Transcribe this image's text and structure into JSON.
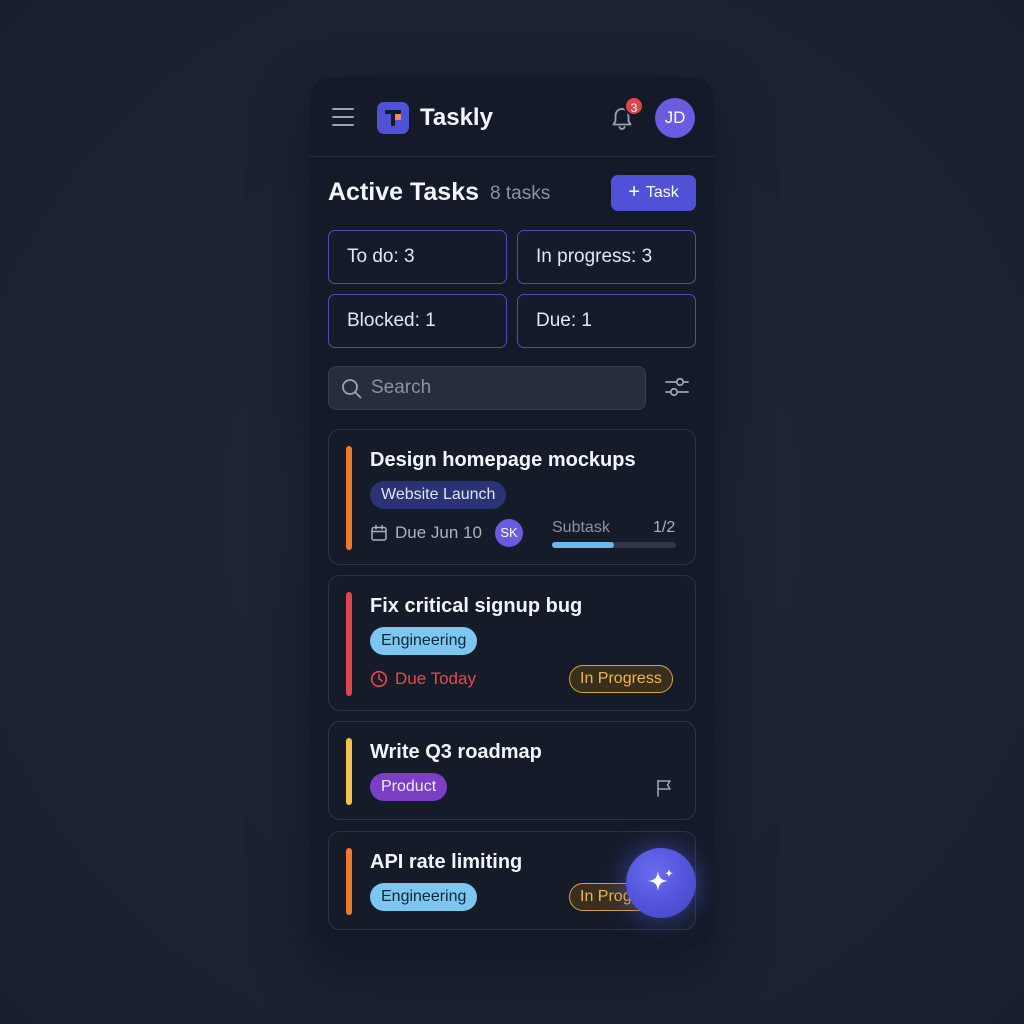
{
  "header": {
    "app_name": "Taskly",
    "notification_count": "3",
    "user_initials": "JD"
  },
  "section": {
    "title": "Active Tasks",
    "count": "8 tasks",
    "add_button_icon": "+",
    "add_button_label": "Task"
  },
  "stats": [
    {
      "label": "To do: 3"
    },
    {
      "label": "In progress: 3"
    },
    {
      "label": "Blocked: 1"
    },
    {
      "label": "Due: 1"
    }
  ],
  "search": {
    "placeholder": "Search",
    "value": ""
  },
  "tasks": [
    {
      "title": "Design homepage mockups",
      "tag": "Website Launch",
      "due": "Due Jun 10",
      "assignee": "SK",
      "subtask_label": "Subtask",
      "subtask_count": "1/2",
      "subtask_progress": 0.5,
      "priority_color": "#f07a2c"
    },
    {
      "title": "Fix critical signup bug",
      "tag": "Engineering",
      "due": "Due Today",
      "status": "In Progress",
      "priority_color": "#e0454b"
    },
    {
      "title": "Write Q3 roadmap",
      "tag": "Product",
      "icon": "flag-icon",
      "priority_color": "#eec44a"
    },
    {
      "title": "API rate limiting",
      "tag": "Engineering",
      "status": "In Progress",
      "priority_color": "#f07a2c"
    }
  ],
  "fab": {
    "icon": "sparkle-icon"
  },
  "colors": {
    "accent": "#4f52d6",
    "background": "#1d2535",
    "panel": "#141a28",
    "danger": "#e0454b",
    "warning": "#f0b64a"
  }
}
